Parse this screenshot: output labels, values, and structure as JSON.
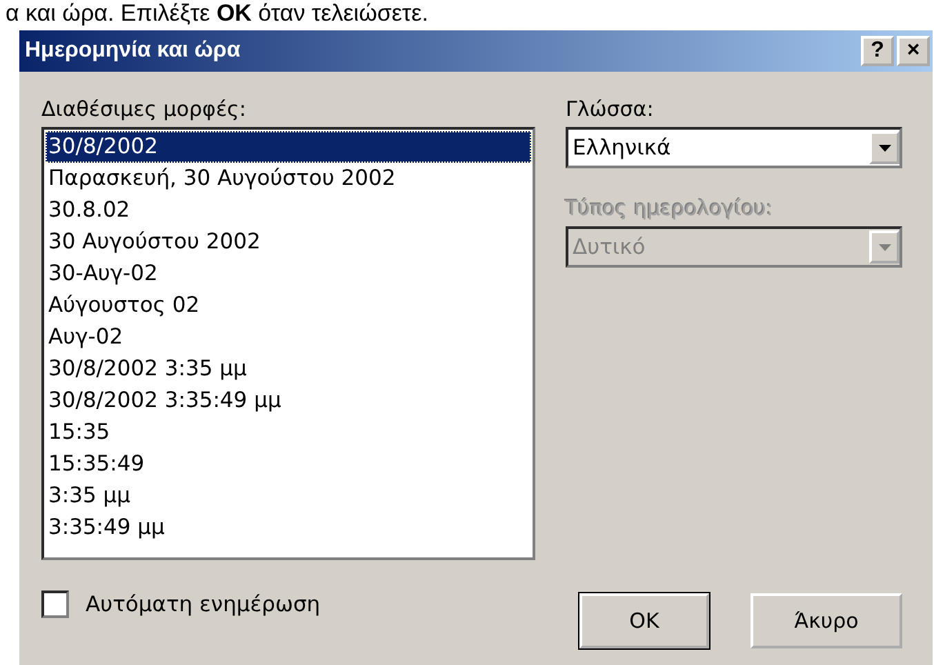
{
  "caption": "α και ώρα. Επιλέξτε **OK** όταν τελειώσετε.",
  "window": {
    "title": "Ημερομηνία και ώρα",
    "help": "?",
    "close": "×"
  },
  "formats": {
    "label": "Διαθέσιμες μορφές:",
    "items": [
      {
        "text": "30/8/2002",
        "selected": true
      },
      {
        "text": "Παρασκευή, 30 Αυγούστου 2002",
        "selected": false
      },
      {
        "text": "30.8.02",
        "selected": false
      },
      {
        "text": "30 Αυγούστου 2002",
        "selected": false
      },
      {
        "text": "30-Αυγ-02",
        "selected": false
      },
      {
        "text": "Αύγουστος 02",
        "selected": false
      },
      {
        "text": "Αυγ-02",
        "selected": false
      },
      {
        "text": "30/8/2002 3:35 μμ",
        "selected": false
      },
      {
        "text": "30/8/2002 3:35:49 μμ",
        "selected": false
      },
      {
        "text": "15:35",
        "selected": false
      },
      {
        "text": "15:35:49",
        "selected": false
      },
      {
        "text": "3:35 μμ",
        "selected": false
      },
      {
        "text": "3:35:49 μμ",
        "selected": false
      }
    ]
  },
  "language": {
    "label": "Γλώσσα:",
    "value": "Ελληνικά",
    "disabled": false
  },
  "calendar": {
    "label": "Τύπος ημερολογίου:",
    "value": "Δυτικό",
    "disabled": true
  },
  "auto_update": {
    "label": "Αυτόματη ενημέρωση",
    "checked": false
  },
  "buttons": [
    {
      "label": "OK",
      "default": true
    },
    {
      "label": "Άκυρο",
      "default": false
    }
  ]
}
